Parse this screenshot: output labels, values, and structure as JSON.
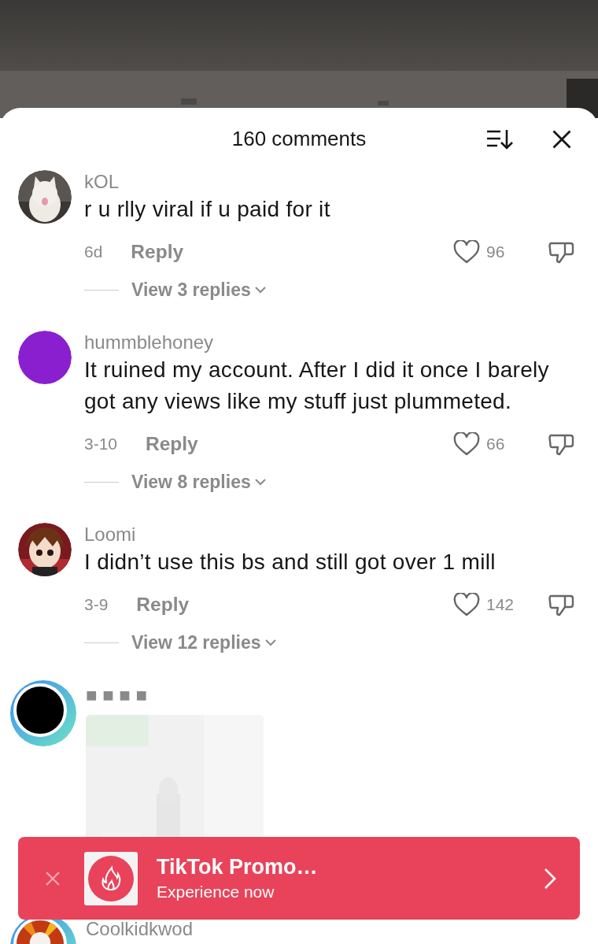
{
  "header": {
    "title": "160 comments"
  },
  "comments": [
    {
      "kind": "text",
      "username": "kOL",
      "story_ring": false,
      "text": "r u rlly viral if u paid for it",
      "date": "6d",
      "reply": "Reply",
      "liked": false,
      "likes": "96",
      "replies": "View 3 replies"
    },
    {
      "kind": "text",
      "username": "hummblehoney",
      "avatar": {
        "kind": "plain",
        "color": "#8a1fcf"
      },
      "story_ring": false,
      "text": "It ruined my account. After I did it once I barely got any views like my stuff just plummeted.",
      "date": "3-10",
      "reply": "Reply",
      "liked": false,
      "likes": "66",
      "replies": "View 8 replies"
    },
    {
      "kind": "text",
      "username": "Loomi",
      "story_ring": false,
      "text": "I didn’t use this bs and still got over 1 mill",
      "date": "3-9",
      "reply": "Reply",
      "liked": false,
      "likes": "142",
      "replies": "View 12 replies"
    },
    {
      "username": "■ ■ ■ ■",
      "avatar": {
        "kind": "plain",
        "color": "#000000"
      },
      "story_ring": true
    },
    {
      "kind": "text",
      "username": "Coolkidkwod",
      "story_ring": true
    }
  ],
  "banner": {
    "title": "TikTok Promo…",
    "subtitle": "Experience now"
  }
}
